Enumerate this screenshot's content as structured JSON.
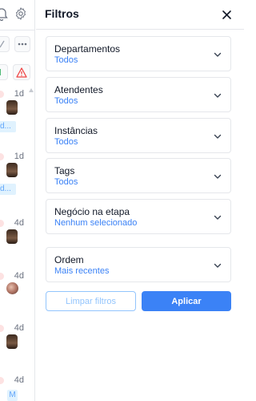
{
  "left_list": {
    "items": [
      {
        "time": "1d",
        "tag": "d..."
      },
      {
        "time": "1d",
        "tag": "d..."
      },
      {
        "time": "4d"
      },
      {
        "time": "4d"
      },
      {
        "time": "4d"
      },
      {
        "time": "4d",
        "badge": "M"
      }
    ]
  },
  "filters_panel": {
    "title": "Filtros",
    "filters": [
      {
        "label": "Departamentos",
        "value": "Todos"
      },
      {
        "label": "Atendentes",
        "value": "Todos"
      },
      {
        "label": "Instâncias",
        "value": "Todos"
      },
      {
        "label": "Tags",
        "value": "Todos"
      },
      {
        "label": "Negócio na etapa",
        "value": "Nenhum selecionado"
      },
      {
        "label": "Ordem",
        "value": "Mais recentes"
      }
    ],
    "clear_label": "Limpar filtros",
    "apply_label": "Aplicar"
  },
  "colors": {
    "accent": "#3b82f6",
    "accent_light": "#93c5fd",
    "border": "#e5e7eb",
    "warning": "#ef4444"
  }
}
